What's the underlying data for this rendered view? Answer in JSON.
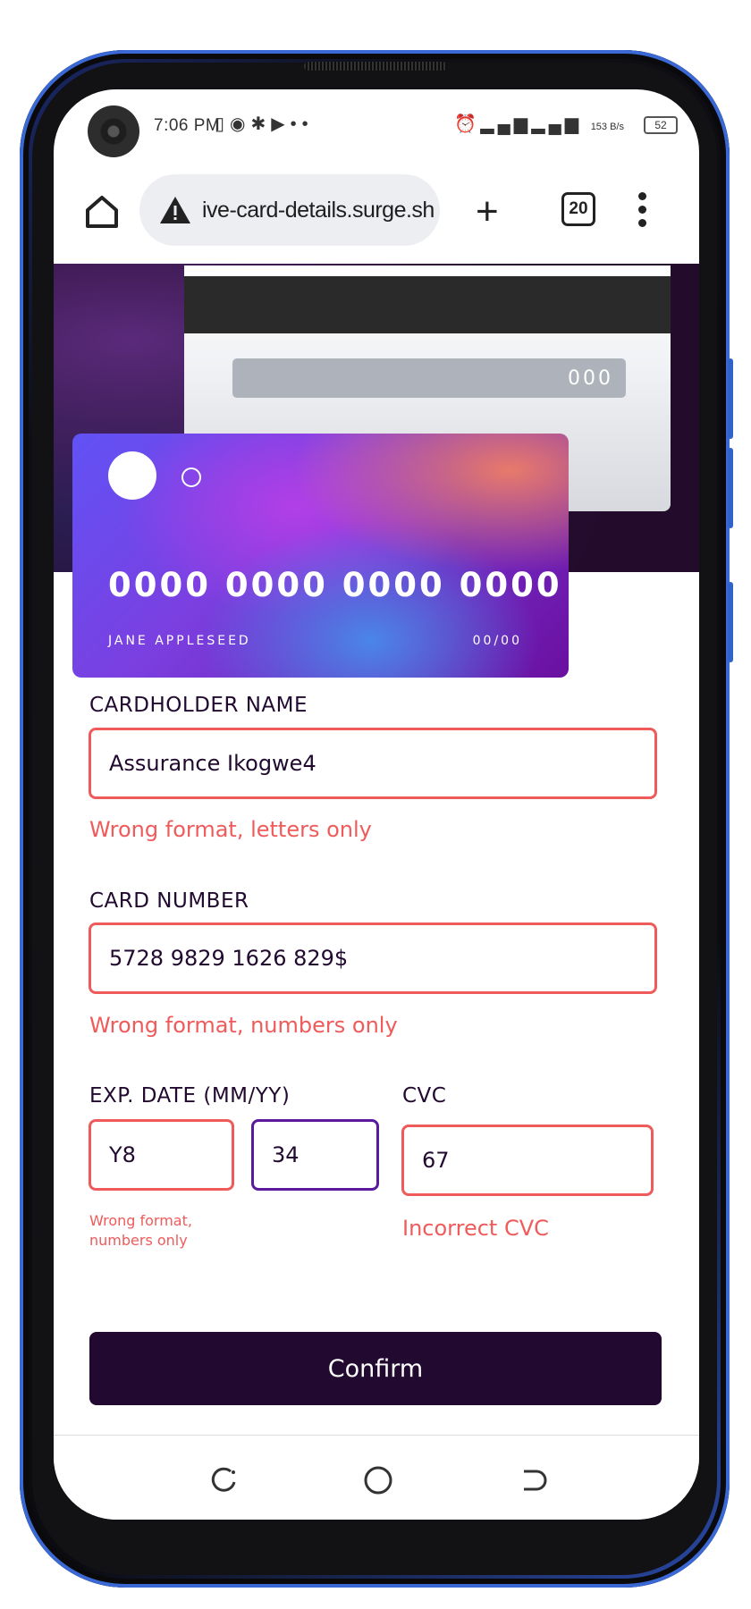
{
  "status_bar": {
    "time": "7:06 PM",
    "left_icons": [
      "battery-charging-icon",
      "hotspot-icon",
      "notification-icon",
      "youtube-icon",
      "more-dots-icon"
    ],
    "right_icons": [
      "alarm-icon",
      "signal-icon",
      "signal-icon"
    ],
    "net_speed": "153 B/s",
    "battery": "52"
  },
  "browser": {
    "url": "ive-card-details.surge.sh",
    "tab_count": "20"
  },
  "card_back": {
    "cvc": "000"
  },
  "card_front": {
    "number": "0000 0000 0000 0000",
    "holder": "JANE APPLESEED",
    "expiry": "00/00"
  },
  "form": {
    "name_label": "CARDHOLDER NAME",
    "name_value": "Assurance Ikogwe4",
    "name_error": "Wrong format, letters only",
    "number_label": "CARD NUMBER",
    "number_value": "5728 9829 1626 829$",
    "number_error": "Wrong format, numbers only",
    "exp_label": "EXP. DATE (MM/YY)",
    "exp_month_value": "Y8",
    "exp_year_value": "34",
    "exp_error": "Wrong format, numbers only",
    "cvc_label": "CVC",
    "cvc_value": "67",
    "cvc_error": "Incorrect CVC",
    "confirm_label": "Confirm"
  },
  "colors": {
    "error": "#ef5b5b",
    "dark_violet": "#21092f",
    "focus_border": "#5a1a9e"
  }
}
